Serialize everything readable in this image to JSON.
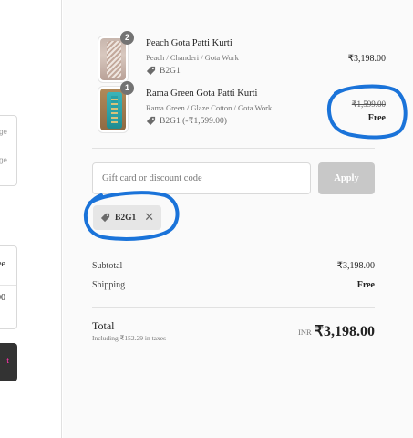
{
  "left_column": {
    "box1_line1": "ge",
    "box1_line2": "ge",
    "box2_line1": "ee",
    "box2_line2": "00",
    "button_glyph": "t"
  },
  "order_summary": {
    "items": [
      {
        "name": "Peach Gota Patti Kurti",
        "quantity": "2",
        "variant": "Peach / Chanderi / Gota Work",
        "discount": "B2G1",
        "price": "₹3,198.00"
      },
      {
        "name": "Rama Green Gota Patti Kurti",
        "quantity": "1",
        "variant": "Rama Green / Glaze Cotton / Gota Work",
        "discount": "B2G1 (-₹1,599.00)",
        "original_price": "₹1,599.00",
        "price": "Free"
      }
    ],
    "discount_code": {
      "placeholder": "Gift card or discount code",
      "value": "",
      "apply_label": "Apply"
    },
    "applied_code": "B2G1",
    "remove_glyph": "✕",
    "subtotal_label": "Subtotal",
    "subtotal_value": "₹3,198.00",
    "shipping_label": "Shipping",
    "shipping_value": "Free",
    "total_label": "Total",
    "tax_note": "Including ₹152.29 in taxes",
    "currency": "INR",
    "total_value": "₹3,198.00"
  },
  "colors": {
    "annotation": "#1a73d9",
    "panel_bg": "#fafafa",
    "badge": "#737373"
  }
}
